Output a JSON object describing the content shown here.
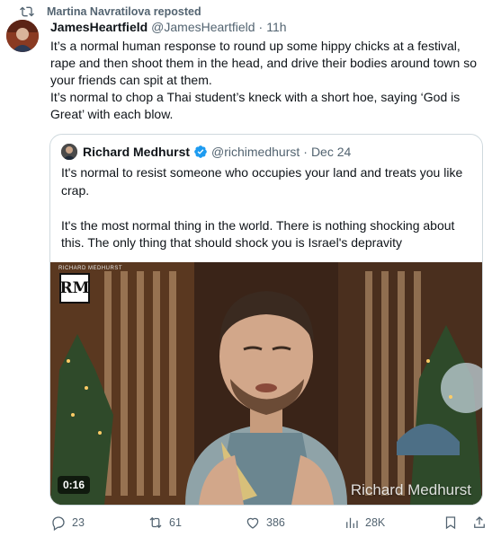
{
  "repost": {
    "icon": "repost-icon",
    "label": "Martina Navratilova reposted"
  },
  "tweet": {
    "author_name": "JamesHeartfield",
    "author_handle": "@JamesHeartfield",
    "separator": "·",
    "time": "11h",
    "text_line1": "It’s a normal human response to round up some hippy chicks at a festival, rape and then shoot them in the head, and drive their bodies around town so your friends can spit at them.",
    "text_line2": "It’s normal to chop a Thai student’s kneck with a short hoe, saying ‘God is Great’ with each blow."
  },
  "quote": {
    "author_name": "Richard Medhurst",
    "author_handle": "@richimedhurst",
    "separator": "·",
    "date": "Dec 24",
    "paragraph1": "It's normal to resist someone who occupies your land and treats you like crap.",
    "paragraph2": "It's the most normal thing in the world. There is nothing shocking about this. The only thing that should shock you is Israel's depravity",
    "media": {
      "logo_text": "RM",
      "logo_caption": "RICHARD MEDHURST",
      "duration": "0:16",
      "watermark": "Richard Medhurst"
    }
  },
  "actions": {
    "replies": "23",
    "reposts": "61",
    "likes": "386",
    "views": "28K"
  },
  "colors": {
    "secondary_text": "#536471",
    "border": "#cfd9de",
    "verified": "#1d9bf0"
  }
}
